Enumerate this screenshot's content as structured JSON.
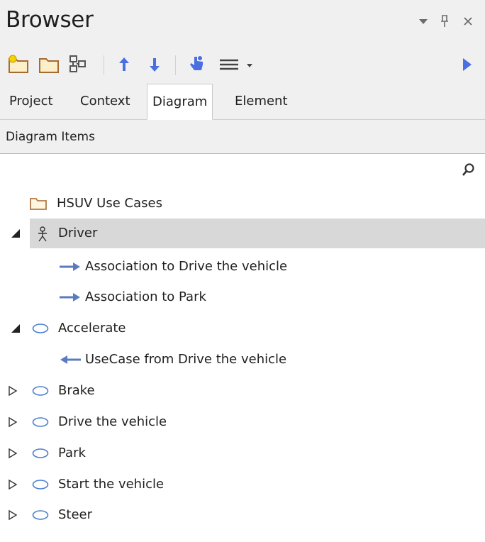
{
  "window": {
    "title": "Browser",
    "controls": [
      "dropdown-icon",
      "pin-icon",
      "close-icon"
    ]
  },
  "toolbar": {
    "icons": [
      "new-package-icon",
      "new-folder-icon",
      "diagram-structure-icon",
      "move-up-icon",
      "move-down-icon",
      "locate-icon",
      "menu-icon",
      "play-icon"
    ]
  },
  "tabs": [
    {
      "label": "Project",
      "active": false
    },
    {
      "label": "Context",
      "active": false
    },
    {
      "label": "Diagram",
      "active": true
    },
    {
      "label": "Element",
      "active": false
    }
  ],
  "subheader": {
    "label": "Diagram Items"
  },
  "tree": {
    "items": [
      {
        "label": "HSUV Use Cases",
        "icon": "folder-icon",
        "expander": "none",
        "selected": false
      },
      {
        "label": "Driver",
        "icon": "actor-icon",
        "expander": "expanded",
        "selected": true
      },
      {
        "label": "Association to Drive the vehicle",
        "icon": "arrow-right-icon",
        "expander": "none",
        "selected": false
      },
      {
        "label": "Association to Park",
        "icon": "arrow-right-icon",
        "expander": "none",
        "selected": false
      },
      {
        "label": "Accelerate",
        "icon": "usecase-icon",
        "expander": "expanded",
        "selected": false
      },
      {
        "label": "UseCase from Drive the vehicle",
        "icon": "arrow-left-icon",
        "expander": "none",
        "selected": false
      },
      {
        "label": "Brake",
        "icon": "usecase-icon",
        "expander": "collapsed",
        "selected": false
      },
      {
        "label": "Drive the vehicle",
        "icon": "usecase-icon",
        "expander": "collapsed",
        "selected": false
      },
      {
        "label": "Park",
        "icon": "usecase-icon",
        "expander": "collapsed",
        "selected": false
      },
      {
        "label": "Start the vehicle",
        "icon": "usecase-icon",
        "expander": "collapsed",
        "selected": false
      },
      {
        "label": "Steer",
        "icon": "usecase-icon",
        "expander": "collapsed",
        "selected": false
      }
    ]
  },
  "colors": {
    "panel_bg": "#f0f0f0",
    "selection": "#d8d8d8",
    "folder": "#b07a4a",
    "folder_fill": "#fdf0c8",
    "arrow": "#5a7bbf",
    "usecase": "#4a7fd0",
    "toolbar_blue": "#4a6fe3"
  }
}
